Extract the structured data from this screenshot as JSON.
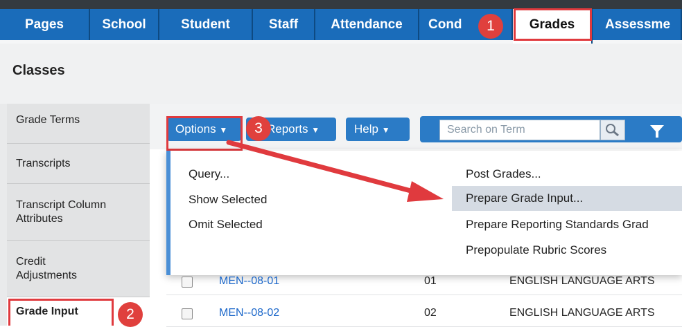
{
  "nav": {
    "tabs": [
      {
        "label": "Pages"
      },
      {
        "label": "School"
      },
      {
        "label": "Student"
      },
      {
        "label": "Staff"
      },
      {
        "label": "Attendance"
      },
      {
        "label": "Cond"
      },
      {
        "label": "Grades"
      },
      {
        "label": "Assessme"
      }
    ],
    "active_tab": "Grades"
  },
  "page": {
    "title": "Classes"
  },
  "sidebar": {
    "items": [
      {
        "label": "Grade Terms"
      },
      {
        "label": "Transcripts"
      },
      {
        "label": "Transcript Column Attributes"
      },
      {
        "label": "Credit Adjustments"
      },
      {
        "label": "Grade Input"
      }
    ]
  },
  "toolbar": {
    "options_label": "Options",
    "reports_label": "Reports",
    "help_label": "Help",
    "search_placeholder": "Search on Term"
  },
  "options_menu": {
    "left_items": [
      {
        "label": "Query..."
      },
      {
        "label": "Show Selected"
      },
      {
        "label": "Omit Selected"
      }
    ],
    "right_items": [
      {
        "label": "Post Grades..."
      },
      {
        "label": "Prepare Grade Input..."
      },
      {
        "label": "Prepare Reporting Standards Grad"
      },
      {
        "label": "Prepopulate Rubric Scores"
      }
    ]
  },
  "table": {
    "rows": [
      {
        "code": "MEN--08-01",
        "section": "01",
        "course": "ENGLISH LANGUAGE ARTS"
      },
      {
        "code": "MEN--08-02",
        "section": "02",
        "course": "ENGLISH LANGUAGE ARTS"
      }
    ]
  },
  "annotations": {
    "badges": [
      "1",
      "2",
      "3"
    ]
  },
  "colors": {
    "nav_blue": "#1a6cba",
    "accent_red": "#e03a3e",
    "link_blue": "#1a66c9"
  }
}
